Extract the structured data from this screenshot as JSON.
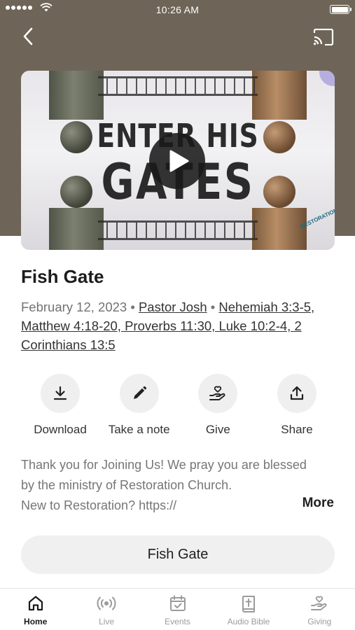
{
  "status_bar": {
    "time": "10:26 AM"
  },
  "header": {
    "back_icon": "chevron-left-icon",
    "cast_icon": "cast-icon"
  },
  "media": {
    "thumbnail_line1": "ENTER HIS",
    "thumbnail_line2": "GATES",
    "thumbnail_brand": "RESTORATION",
    "play_icon": "play-icon"
  },
  "sermon": {
    "title": "Fish Gate",
    "date": "February 12, 2023",
    "separator": " • ",
    "speaker": "Pastor Josh",
    "scripture": "Nehemiah 3:3-5, Matthew 4:18-20, Proverbs 11:30, Luke 10:2-4, 2 Corinthians 13:5"
  },
  "actions": [
    {
      "label": "Download",
      "icon": "download-icon"
    },
    {
      "label": "Take a note",
      "icon": "pencil-icon"
    },
    {
      "label": "Give",
      "icon": "giving-hand-icon"
    },
    {
      "label": "Share",
      "icon": "share-icon"
    }
  ],
  "description": {
    "line1": "Thank you for Joining Us! We pray you are blessed",
    "line2": "by the ministry of Restoration Church.",
    "line3": "New to Restoration? https://",
    "more_label": "More"
  },
  "series_button": {
    "label": "Fish Gate"
  },
  "tabbar": [
    {
      "label": "Home",
      "icon": "home-icon",
      "active": true
    },
    {
      "label": "Live",
      "icon": "live-broadcast-icon",
      "active": false
    },
    {
      "label": "Events",
      "icon": "calendar-icon",
      "active": false
    },
    {
      "label": "Audio Bible",
      "icon": "bible-icon",
      "active": false
    },
    {
      "label": "Giving",
      "icon": "giving-hand-icon",
      "active": false
    }
  ],
  "colors": {
    "header_bg": "#6e6558",
    "active_tab": "#1a1a1a",
    "inactive_tab": "#9b9b9b"
  }
}
